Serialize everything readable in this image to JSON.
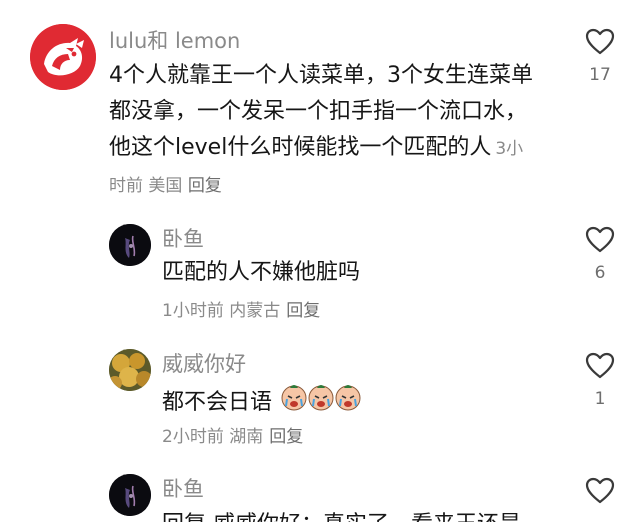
{
  "comments": [
    {
      "username": "lulu和 lemon",
      "text": "4个人就靠王一个人读菜单，3个女生连菜单都没拿，一个发呆一个扣手指一个流口水，他这个level什么时候能找一个匹配的人",
      "time": "3小时前",
      "location": "美国",
      "reply_label": "回复",
      "likes": "17"
    },
    {
      "username": "卧鱼",
      "text": "匹配的人不嫌他脏吗",
      "time": "1小时前",
      "location": "内蒙古",
      "reply_label": "回复",
      "likes": "6"
    },
    {
      "username": "威威你好",
      "text": "都不会日语",
      "emoji": "crying-emoji",
      "time": "2小时前",
      "location": "湖南",
      "reply_label": "回复",
      "likes": "1"
    },
    {
      "username": "卧鱼",
      "text": "回复 威威你好：真实了，看来王还是"
    }
  ],
  "colors": {
    "name_gray": "#8a8a8a",
    "brand_red": "#d81f2a"
  }
}
